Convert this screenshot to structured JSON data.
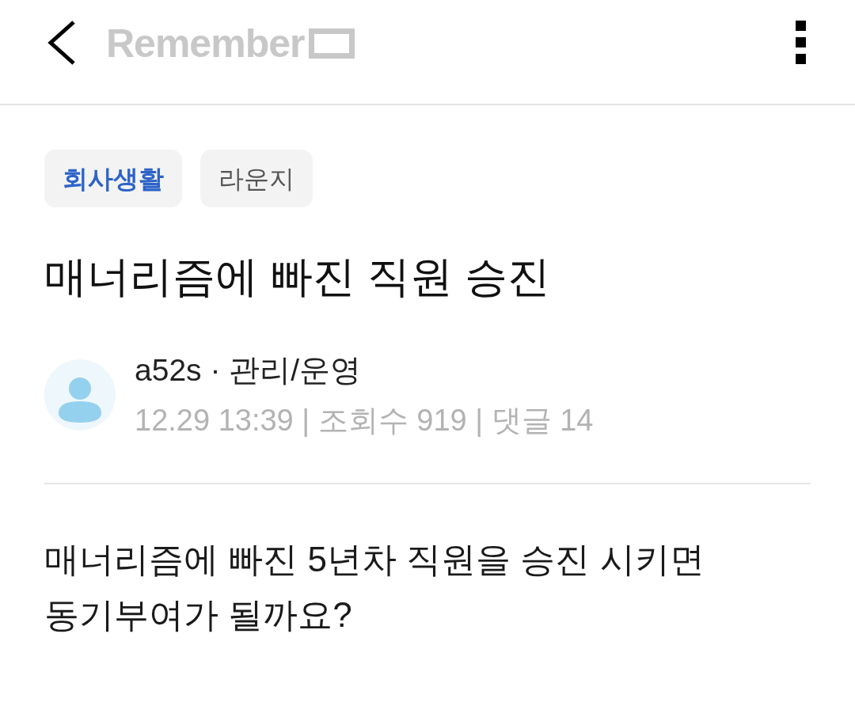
{
  "header": {
    "logo_text": "Remember"
  },
  "tags": [
    {
      "label": "회사생활",
      "selected": true
    },
    {
      "label": "라운지",
      "selected": false
    }
  ],
  "post": {
    "title": "매너리즘에 빠진 직원 승진",
    "author": {
      "name_line": "a52s · 관리/운영",
      "meta": "12.29 13:39 | 조회수 919 | 댓글 14"
    },
    "body": "매너리즘에 빠진 5년차 직원을 승진 시키면 동기부여가 될까요?"
  }
}
